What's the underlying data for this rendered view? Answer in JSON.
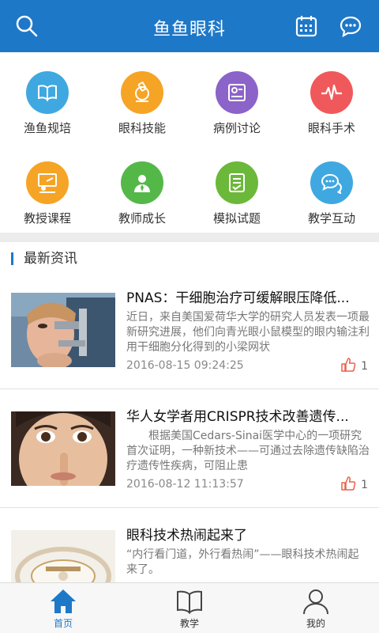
{
  "header": {
    "title": "鱼鱼眼科",
    "left_icon": "search-icon",
    "right_icons": [
      "calendar-icon",
      "chat-bubble-icon"
    ],
    "bg_color": "#1e78c8"
  },
  "grid": [
    {
      "label": "渔鱼规培",
      "icon": "book-icon",
      "color": "#3fa8e0"
    },
    {
      "label": "眼科技能",
      "icon": "microscope-icon",
      "color": "#f6a425"
    },
    {
      "label": "病例讨论",
      "icon": "case-file-icon",
      "color": "#8b63c9"
    },
    {
      "label": "眼科手术",
      "icon": "pulse-icon",
      "color": "#f0595b"
    },
    {
      "label": "教授课程",
      "icon": "lecture-board-icon",
      "color": "#f6a425"
    },
    {
      "label": "教师成长",
      "icon": "teacher-icon",
      "color": "#54b848"
    },
    {
      "label": "模拟试题",
      "icon": "checklist-icon",
      "color": "#6cb83a"
    },
    {
      "label": "教学互动",
      "icon": "chat-bubbles-icon",
      "color": "#3fa8e0"
    }
  ],
  "section": {
    "title": "最新资讯"
  },
  "news": [
    {
      "title": "PNAS：干细胞治疗可缓解眼压降低...",
      "desc": "近日，来自美国爱荷华大学的研究人员发表一项最新研究进展，他们向青光眼小鼠模型的眼内输注利用干细胞分化得到的小梁网状",
      "date": "2016-08-15 09:24:25",
      "likes": "1"
    },
    {
      "title": "华人女学者用CRISPR技术改善遗传...",
      "desc": "　　根据美国Cedars-Sinai医学中心的一项研究首次证明，一种新技术——可通过去除遗传缺陷治疗遗传性疾病，可阻止患",
      "date": "2016-08-12 11:13:57",
      "likes": "1"
    },
    {
      "title": "眼科技术热闹起来了",
      "desc": "“内行看门道，外行看热闹”——眼科技术热闹起来了。",
      "date": "",
      "likes": ""
    }
  ],
  "tabs": [
    {
      "label": "首页",
      "icon": "home-icon",
      "active": true
    },
    {
      "label": "教学",
      "icon": "open-book-icon",
      "active": false
    },
    {
      "label": "我的",
      "icon": "user-icon",
      "active": false
    }
  ]
}
